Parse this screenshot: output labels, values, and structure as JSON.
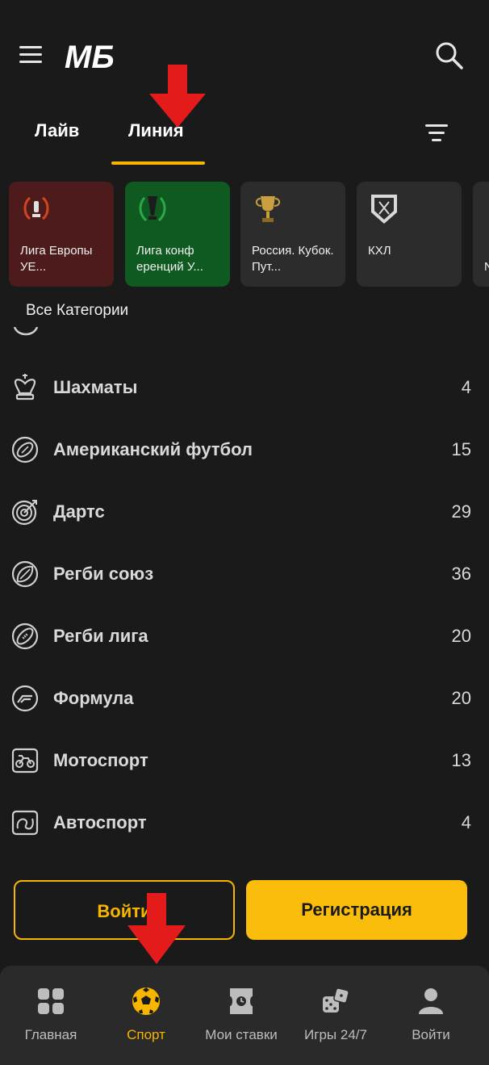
{
  "header": {
    "logo_text": "МБ",
    "menu_icon": "hamburger-menu-icon",
    "search_icon": "search-icon"
  },
  "tabs": [
    {
      "label": "Лайв",
      "active": false
    },
    {
      "label": "Линия",
      "active": true
    }
  ],
  "accent_color": "#f7b500",
  "featured": [
    {
      "label": "Лига Европы УЕ...",
      "icon": "europa-league-icon",
      "color": "#4d1b1b"
    },
    {
      "label": "Лига конф еренций У...",
      "icon": "conference-league-icon",
      "color": "#0e5a20"
    },
    {
      "label": "Россия. Кубок. Пут...",
      "icon": "trophy-icon",
      "color": "#2c2c2c"
    },
    {
      "label": "КХЛ",
      "icon": "khl-icon",
      "color": "#2c2c2c"
    },
    {
      "label": "N",
      "icon": "partial-card-icon",
      "color": "#2c2c2c"
    }
  ],
  "all_categories_label": "Все Категории",
  "sports": [
    {
      "name": "Шахматы",
      "count": "4",
      "icon": "chess-icon"
    },
    {
      "name": "Американский футбол",
      "count": "15",
      "icon": "american-football-icon"
    },
    {
      "name": "Дартс",
      "count": "29",
      "icon": "darts-icon"
    },
    {
      "name": "Регби союз",
      "count": "36",
      "icon": "rugby-union-icon"
    },
    {
      "name": "Регби лига",
      "count": "20",
      "icon": "rugby-league-icon"
    },
    {
      "name": "Формула",
      "count": "20",
      "icon": "formula-icon"
    },
    {
      "name": "Мотоспорт",
      "count": "13",
      "icon": "motorsport-icon"
    },
    {
      "name": "Автоспорт",
      "count": "4",
      "icon": "autosport-icon"
    }
  ],
  "auth": {
    "login_label": "Войти",
    "register_label": "Регистрация"
  },
  "bottom_nav": [
    {
      "label": "Главная",
      "icon": "home-grid-icon",
      "active": false
    },
    {
      "label": "Спорт",
      "icon": "soccer-ball-icon",
      "active": true
    },
    {
      "label": "Мои ставки",
      "icon": "ticket-icon",
      "active": false
    },
    {
      "label": "Игры 24/7",
      "icon": "dice-icon",
      "active": false
    },
    {
      "label": "Войти",
      "icon": "user-icon",
      "active": false
    }
  ]
}
